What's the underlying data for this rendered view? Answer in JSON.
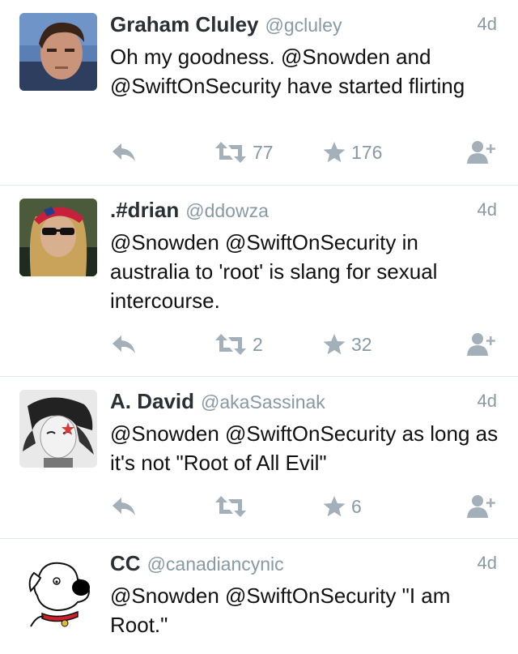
{
  "tweets": [
    {
      "name": "Graham Cluley",
      "handle": "@gcluley",
      "time": "4d",
      "text": "Oh my goodness. @Snowden and @SwiftOnSecurity have started flirting",
      "retweets": "77",
      "favorites": "176",
      "avatar_colors": {
        "bg": "#5a7fb4",
        "skin": "#c9947a",
        "hair": "#3a2418",
        "shirt": "#2d3e5f"
      }
    },
    {
      "name": ".#drian",
      "handle": "@ddowza",
      "time": "4d",
      "text": "@Snowden @SwiftOnSecurity in australia to 'root' is slang for sexual intercourse.",
      "retweets": "2",
      "favorites": "32",
      "avatar_colors": {
        "bg": "#4b5a3a",
        "skin": "#d8b090",
        "hair": "#c9a35a",
        "shirt": "#1f2a20"
      }
    },
    {
      "name": "A. David",
      "handle": "@akaSassinak",
      "time": "4d",
      "text": "@Snowden @SwiftOnSecurity as long as it's not \"Root of All Evil\"",
      "retweets": "",
      "favorites": "6",
      "avatar_colors": {
        "bg": "#e9e9e9",
        "skin": "#f2f2f2",
        "hair": "#222222",
        "shirt": "#777777"
      }
    },
    {
      "name": "CC",
      "handle": "@canadiancynic",
      "time": "4d",
      "text": "@Snowden @SwiftOnSecurity \"I am Root.\"",
      "retweets": "",
      "favorites": "",
      "avatar_colors": {
        "bg": "#ffffff",
        "skin": "#ffffff",
        "hair": "#000000",
        "shirt": "#d01f2a"
      }
    }
  ],
  "icons": {
    "reply": "reply-icon",
    "retweet": "retweet-icon",
    "favorite": "star-icon",
    "follow": "follow-icon"
  },
  "colors": {
    "name": "#292f33",
    "meta": "#8899a6",
    "icon": "#a3b0ba",
    "divider": "#e1e8ed"
  }
}
